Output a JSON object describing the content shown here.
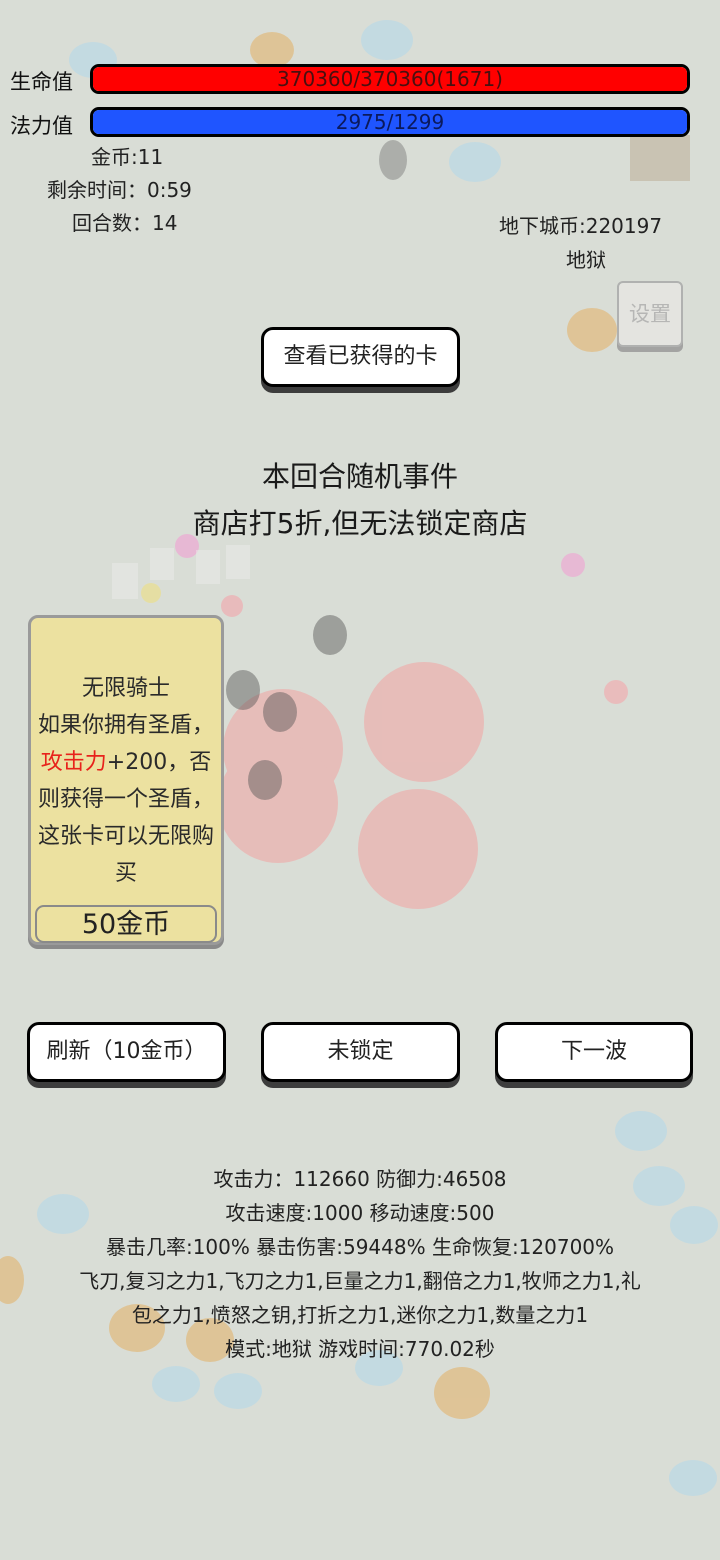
{
  "hud": {
    "hp_label": "生命值",
    "hp_text": "370360/370360(1671)",
    "hp_fill": 1.0,
    "mp_label": "法力值",
    "mp_text": "2975/1299",
    "mp_fill": 1.0,
    "gold": "金币:11",
    "time_left": "剩余时间：0:59",
    "round": "回合数：14",
    "dungeon_coins": "地下城币:220197",
    "difficulty": "地狱",
    "settings_label": "设置"
  },
  "buttons": {
    "view_cards": "查看已获得的卡",
    "refresh": "刷新（10金币）",
    "lock": "未锁定",
    "next_wave": "下一波"
  },
  "event": {
    "title": "本回合随机事件",
    "description": "商店打5折,但无法锁定商店"
  },
  "card": {
    "title": "无限骑士",
    "text_before": "如果你拥有圣盾，",
    "text_highlight": "攻击力",
    "text_after": "+200，否则获得一个圣盾，这张卡可以无限购买",
    "price": "50金币"
  },
  "stats": {
    "line1": "攻击力：112660 防御力:46508",
    "line2": "攻击速度:1000 移动速度:500",
    "line3": "暴击几率:100% 暴击伤害:59448% 生命恢复:120700%",
    "line4": "飞刀,复习之力1,飞刀之力1,巨量之力1,翻倍之力1,牧师之力1,礼",
    "line5": "包之力1,愤怒之钥,打折之力1,迷你之力1,数量之力1",
    "line6": "模式:地狱 游戏时间:770.02秒"
  },
  "colors": {
    "background": "#d9ddd6",
    "hp_bar": "#ff0000",
    "mp_bar": "#1f55ff",
    "card_bg": "#ece1a0",
    "highlight": "#e8221b"
  }
}
